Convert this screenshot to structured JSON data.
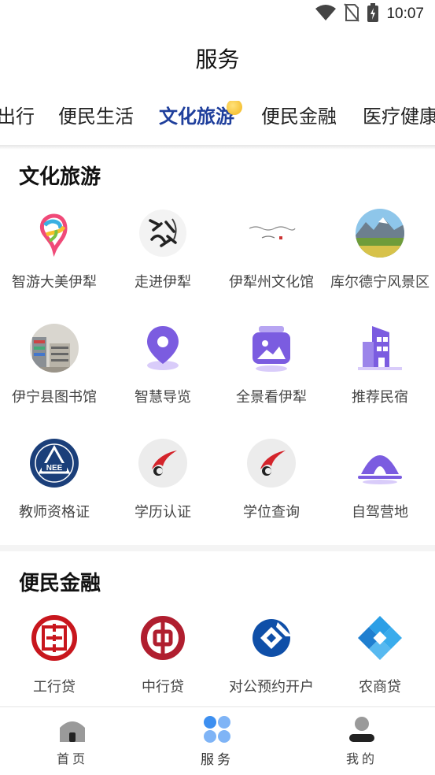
{
  "status": {
    "time": "10:07"
  },
  "header": {
    "title": "服务"
  },
  "tabs": [
    {
      "label": "出行"
    },
    {
      "label": "便民生活"
    },
    {
      "label": "文化旅游"
    },
    {
      "label": "便民金融"
    },
    {
      "label": "医疗健康"
    }
  ],
  "culture": {
    "title": "文化旅游",
    "items": [
      {
        "label": "智游大美伊犁",
        "icon": "colorful-swirl-logo-icon"
      },
      {
        "label": "走进伊犁",
        "icon": "calligraphy-seal-icon"
      },
      {
        "label": "伊犁州文化馆",
        "icon": "calligraphy-banner-icon"
      },
      {
        "label": "库尔德宁风景区",
        "icon": "mountain-landscape-photo"
      },
      {
        "label": "伊宁县图书馆",
        "icon": "library-photo"
      },
      {
        "label": "智慧导览",
        "icon": "location-pin-icon"
      },
      {
        "label": "全景看伊犁",
        "icon": "panorama-photo-icon"
      },
      {
        "label": "推荐民宿",
        "icon": "homestay-building-icon"
      },
      {
        "label": "教师资格证",
        "icon": "teacher-cert-emblem-icon"
      },
      {
        "label": "学历认证",
        "icon": "red-swoosh-logo-icon"
      },
      {
        "label": "学位查询",
        "icon": "red-swoosh-logo-icon"
      },
      {
        "label": "自驾营地",
        "icon": "camping-tent-icon"
      }
    ]
  },
  "finance": {
    "title": "便民金融",
    "items": [
      {
        "label": "工行贷",
        "icon": "icbc-logo-icon"
      },
      {
        "label": "中行贷",
        "icon": "boc-logo-icon"
      },
      {
        "label": "对公预约开户",
        "icon": "ccb-logo-icon"
      },
      {
        "label": "农商贷",
        "icon": "rural-bank-logo-icon"
      }
    ]
  },
  "bottom_nav": [
    {
      "label": "首页",
      "icon": "home-icon"
    },
    {
      "label": "服务",
      "icon": "services-grid-icon"
    },
    {
      "label": "我的",
      "icon": "profile-icon"
    }
  ],
  "colors": {
    "active_tab": "#1f3f9c",
    "purple": "#7b5ce0",
    "icbc_red": "#c8161d",
    "boc_red": "#b01e2f",
    "ccb_blue": "#0f4fa8"
  }
}
